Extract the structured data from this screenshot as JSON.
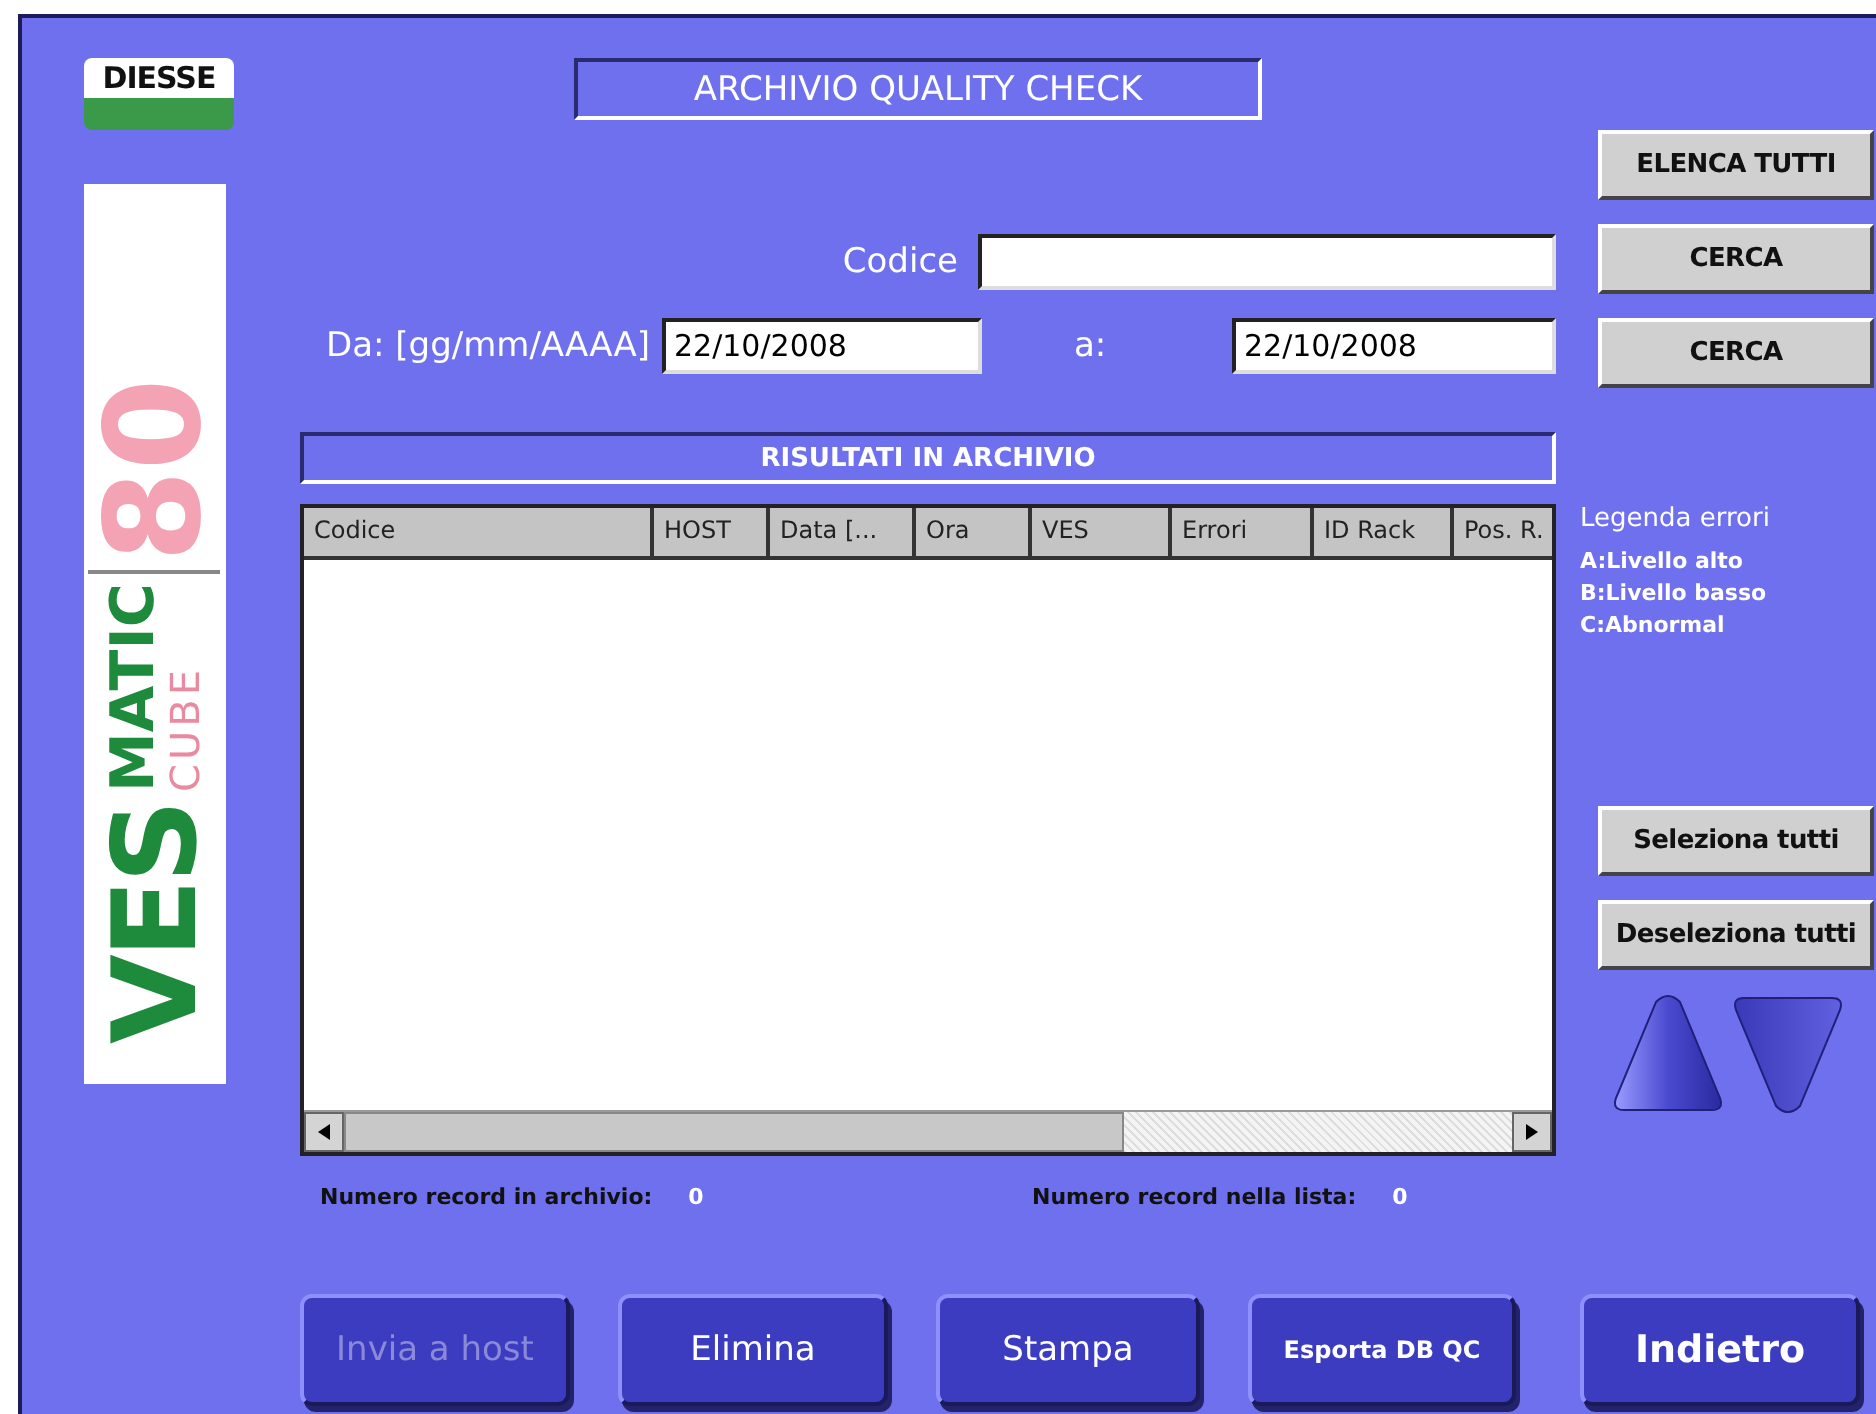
{
  "logo": {
    "brand": "DIESSE",
    "product": "VES",
    "suffix": "MATIC",
    "line": "CUBE",
    "model": "80"
  },
  "title": "ARCHIVIO QUALITY CHECK",
  "search": {
    "code_label": "Codice",
    "from_label": "Da: [gg/mm/AAAA]",
    "from_value": "22/10/2008",
    "to_label": "a:",
    "to_value": "22/10/2008"
  },
  "results_title": "RISULTATI IN ARCHIVIO",
  "table": {
    "columns": [
      "Codice",
      "HOST",
      "Data [...",
      "Ora",
      "VES",
      "Errori",
      "ID Rack",
      "Pos. R."
    ]
  },
  "counts": [
    {
      "label": "Numero record in archivio:",
      "value": "0"
    },
    {
      "label": "Numero record nella lista:",
      "value": "0"
    }
  ],
  "side_buttons": [
    "ELENCA TUTTI",
    "CERCA",
    "CERCA"
  ],
  "legend": {
    "title": "Legenda errori",
    "items": [
      "A:Livello alto",
      "B:Livello basso",
      "C:Abnormal"
    ]
  },
  "selection_buttons": [
    "Seleziona tutti",
    "Deseleziona tutti"
  ],
  "bottom_buttons": [
    {
      "label": "Invia a host",
      "disabled": true,
      "kind": "plain"
    },
    {
      "label": "Elimina",
      "disabled": false,
      "kind": "plain"
    },
    {
      "label": "Stampa",
      "disabled": false,
      "kind": "plain"
    },
    {
      "label": "Esporta DB QC",
      "disabled": false,
      "kind": "small"
    },
    {
      "label": "Indietro",
      "disabled": false,
      "kind": "strong"
    }
  ]
}
